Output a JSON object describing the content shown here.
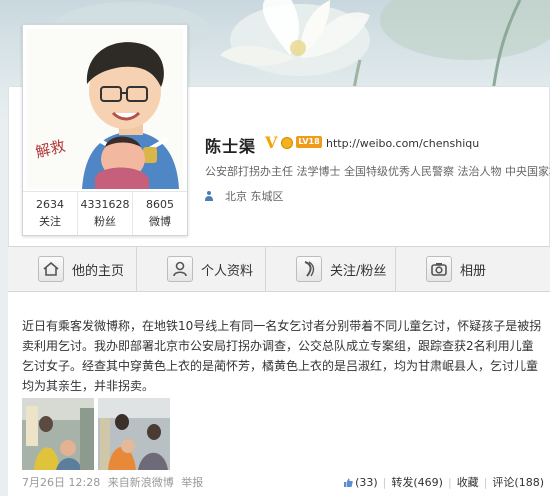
{
  "profile": {
    "name": "陈士渠",
    "verified_badge": "V",
    "vip_badge": "LV18",
    "url": "http://weibo.com/chenshiqu",
    "description": "公安部打拐办主任 法学博士 全国特级优秀人民警察 法治人物 中央国家机",
    "location": "北京 东城区",
    "avatar_caption": "解救"
  },
  "stats": [
    {
      "value": "2634",
      "label": "关注"
    },
    {
      "value": "4331628",
      "label": "粉丝"
    },
    {
      "value": "8605",
      "label": "微博"
    }
  ],
  "tabs": [
    {
      "label": "他的主页",
      "icon": "home-icon"
    },
    {
      "label": "个人资料",
      "icon": "profile-icon"
    },
    {
      "label": "关注/粉丝",
      "icon": "follow-icon"
    },
    {
      "label": "相册",
      "icon": "camera-icon"
    }
  ],
  "post": {
    "text": "近日有乘客发微博称，在地铁10号线上有同一名女乞讨者分别带着不同儿童乞讨，怀疑孩子是被拐卖利用乞讨。我办即部署北京市公安局打拐办调查，公交总队成立专案组，跟踪查获2名利用儿童乞讨女子。经查其中穿黄色上衣的是蔺怀芳，橘黄色上衣的是吕淑红，均为甘肃岷县人，乞讨儿童均为其亲生，并非拐卖。",
    "time": "7月26日 12:28",
    "source": "来自新浪微博",
    "report": "举报",
    "like": "(33)",
    "repost": "转发(469)",
    "favorite": "收藏",
    "comment": "评论(188)"
  },
  "colors": {
    "accent_gold": "#f5a300",
    "link": "#333333",
    "background": "#e9eef0"
  }
}
